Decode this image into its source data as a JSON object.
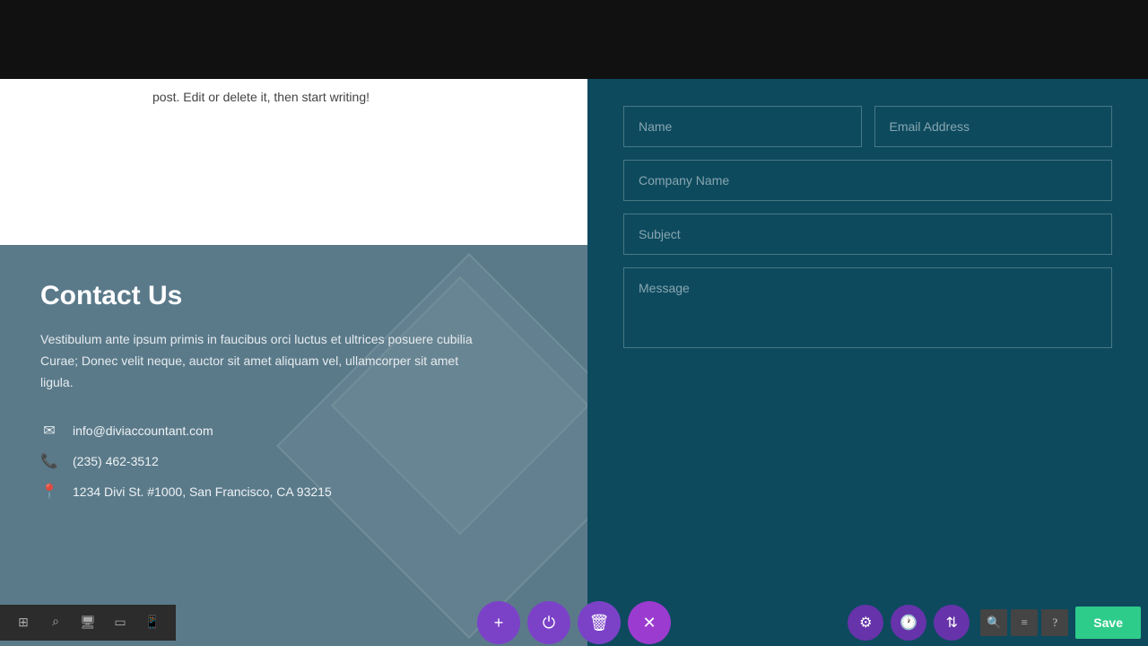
{
  "topBar": {
    "background": "#111"
  },
  "leftWhite": {
    "text": "post. Edit or delete it, then start writing!"
  },
  "leftBlue": {
    "title": "Contact Us",
    "description": "Vestibulum ante ipsum primis in faucibus orci luctus et ultrices posuere cubilia Curae; Donec velit neque, auctor sit amet aliquam vel, ullamcorper sit amet ligula.",
    "email": "info@diviaccountant.com",
    "phone": "(235) 462-3512",
    "address": "1234 Divi St. #1000, San Francisco, CA 93215"
  },
  "contactForm": {
    "namePlaceholder": "Name",
    "emailPlaceholder": "Email Address",
    "companyPlaceholder": "Company Name",
    "subjectPlaceholder": "Subject",
    "messagePlaceholder": "Message"
  },
  "toolbar": {
    "addLabel": "+",
    "saveLabel": "Save",
    "icons": {
      "grid": "⊞",
      "search": "⌕",
      "desktop": "🖥",
      "tablet": "▭",
      "mobile": "📱",
      "power": "⏻",
      "trash": "🗑",
      "close": "✕",
      "settings": "⚙",
      "clock": "🕐",
      "sort": "⇅",
      "magnify": "🔍",
      "sliders": "⊟",
      "question": "?"
    }
  }
}
